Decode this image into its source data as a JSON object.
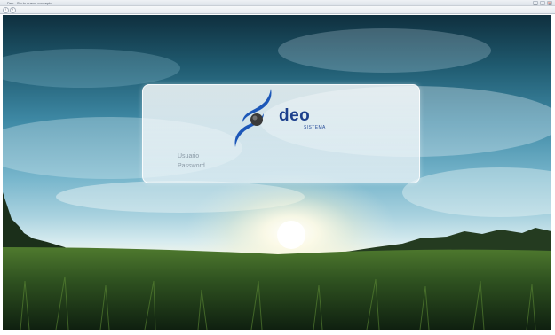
{
  "browser": {
    "title": "Deo - Sin tu nuevo concepto",
    "controls": {
      "minimize": "—",
      "maximize": "▫",
      "close": "✕"
    },
    "nav": {
      "back_icon": "back-arrow-icon",
      "forward_icon": "forward-arrow-icon",
      "back_glyph": "‹",
      "forward_glyph": "›"
    }
  },
  "login": {
    "brand": {
      "name": "deo",
      "subtitle": "SISTEMA",
      "logo_icon": "deo-logo-icon",
      "colors": {
        "swoosh": "#1c57b8",
        "sphere": "#3a3a3a",
        "text": "#1c3f8c"
      }
    },
    "fields": {
      "username_label": "Usuario",
      "password_label": "Password",
      "username_value": "",
      "password_value": ""
    }
  }
}
